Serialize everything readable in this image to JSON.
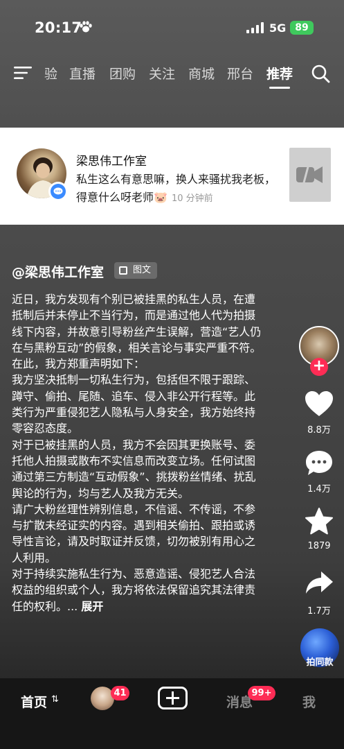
{
  "status_bar": {
    "time": "20:17",
    "network": "5G",
    "battery": "89"
  },
  "nav": {
    "tabs": [
      "验",
      "直播",
      "团购",
      "关注",
      "商城",
      "邢台",
      "推荐"
    ],
    "active": "推荐"
  },
  "notification": {
    "name": "梁思伟工作室",
    "text": "私生这么有意思嘛，换人来骚扰我老板，得意什么呀老师🐷",
    "time": "10 分钟前"
  },
  "post": {
    "author": "@梁思伟工作室",
    "tag": "图文",
    "paragraphs": [
      "近日，我方发现有个别已被挂黑的私生人员，在遭抵制后并未停止不当行为，而是通过他人代为拍摄线下内容，并故意引导粉丝产生误解，营造“艺人仍在与黑粉互动”的假象，相关言论与事实严重不符。",
      "在此，我方郑重声明如下：",
      "我方坚决抵制一切私生行为，包括但不限于跟踪、蹲守、偷拍、尾随、追车、侵入非公开行程等。此类行为严重侵犯艺人隐私与人身安全，我方始终持零容忍态度。",
      "对于已被挂黑的人员，我方不会因其更换账号、委托他人拍摄或散布不实信息而改变立场。任何试图通过第三方制造“互动假象”、挑拨粉丝情绪、扰乱舆论的行为，均与艺人及我方无关。",
      "请广大粉丝理性辨别信息，不信谣、不传谣，不参与扩散未经证实的内容。遇到相关偷拍、跟拍或诱导性言论，请及时取证并反馈，切勿被别有用心之人利用。",
      "对于持续实施私生行为、恶意造谣、侵犯艺人合法权益的组织或个人，我方将依法保留追究其法律责任的权利。..."
    ],
    "expand": "展开"
  },
  "rail": {
    "likes": "8.8万",
    "comments": "1.4万",
    "favorites": "1879",
    "shares": "1.7万",
    "same_label": "拍同款"
  },
  "bottom_bar": {
    "home": "首页",
    "friend_badge": "41",
    "messages": "消息",
    "messages_badge": "99+",
    "me": "我"
  },
  "colors": {
    "accent_red": "#fe2c55",
    "battery_green": "#3fc95d",
    "msg_badge_blue": "#3a8bff"
  }
}
